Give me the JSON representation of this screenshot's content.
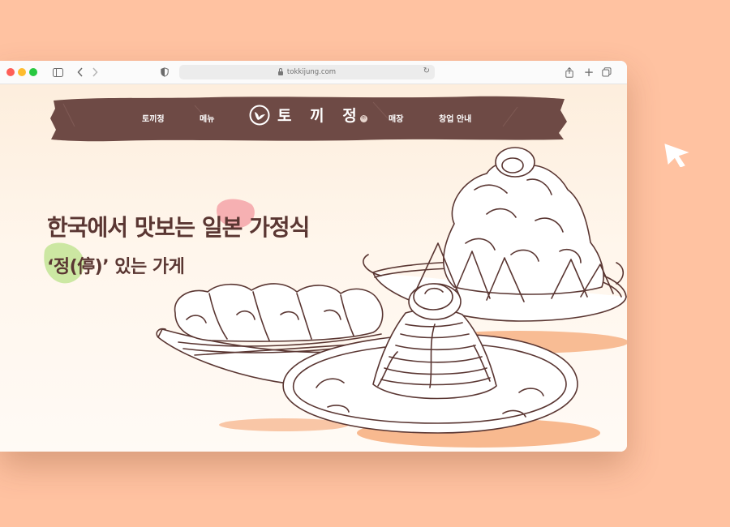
{
  "browser": {
    "url": "tokkijung.com"
  },
  "nav": {
    "items": [
      "토끼정",
      "메뉴",
      "매장",
      "창업 안내"
    ],
    "logo_text": "토 끼 정",
    "logo_badge": "㈜"
  },
  "hero": {
    "title": "한국에서 맛보는 일본 가정식",
    "subtitle": "‘정(停)’ 있는 가게"
  },
  "colors": {
    "background": "#ffc2a1",
    "nav_band": "#6e4a45",
    "text": "#5a3632",
    "highlight_pink": "#f5a3a8",
    "highlight_green": "#c7e59a",
    "plate_shadow": "#f7b184"
  }
}
